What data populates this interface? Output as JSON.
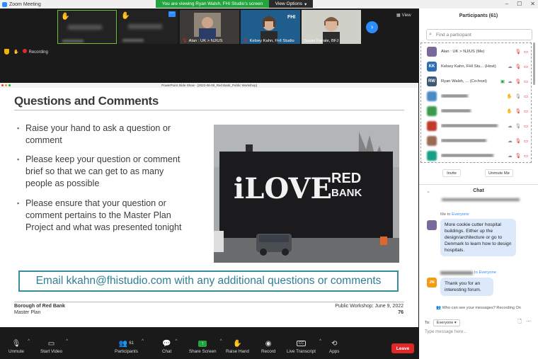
{
  "window": {
    "title": "Zoom Meeting"
  },
  "banner": {
    "text": "You are viewing Ryan Walsh, FHI Studio's screen",
    "view_options": "View Options"
  },
  "gallery": {
    "view_label": "View",
    "tiles": [
      {
        "name": "Alan : UK > NJ/US",
        "hand": true
      },
      {
        "name": "Kelsey Kahn, FHI Studio"
      },
      {
        "name": "Susan Favate, BFJ"
      }
    ]
  },
  "security": {
    "recording_label": "Recording"
  },
  "slide_window": {
    "title": "PowerPoint Slide Show - [2022-06-09_Red Bank_Public Workshop]"
  },
  "slide": {
    "title": "Questions and Comments",
    "bullets": [
      "Raise your hand to ask a question or comment",
      "Please keep your question or comment brief so that we can get to as many people as possible",
      "Please ensure that your question or comment pertains to the Master Plan Project and what was presented tonight"
    ],
    "mural_text_big": "iLOVE",
    "mural_text_red": "RED",
    "mural_text_bank": "BANK",
    "email_line": "Email kkahn@fhistudio.com with any additional questions or comments",
    "footer_org": "Borough of Red Bank",
    "footer_doc": "Master Plan",
    "footer_date": "Public Workshop: June 9, 2022",
    "page_number": "76"
  },
  "toolbar": {
    "unmute": "Unmute",
    "start_video": "Start Video",
    "participants": "Participants",
    "participants_count": "61",
    "chat": "Chat",
    "share_screen": "Share Screen",
    "raise_hand": "Raise Hand",
    "record": "Record",
    "live_transcript": "Live Transcript",
    "live_transcript_badge": "CC",
    "apps": "Apps",
    "leave": "Leave"
  },
  "participants_panel": {
    "title": "Participants (61)",
    "search_placeholder": "Find a participant",
    "rows": [
      {
        "name": "Alan : UK > NJ/US (Me)",
        "initials": "",
        "color": "#7a6a9a"
      },
      {
        "name": "Kelsey Kahn, FHI Stu... (Host)",
        "initials": "KK",
        "color": "#2d6db5"
      },
      {
        "name": "Ryan Walsh, ... (Co-host)",
        "initials": "RW",
        "color": "#3c5a73"
      }
    ],
    "invite": "Invite",
    "unmute_me": "Unmute Me"
  },
  "chat_panel": {
    "title": "Chat",
    "msg1_meta_prefix": "Me to ",
    "msg1_meta_target": "Everyone",
    "msg1_text": "More cookie cutter hospital buildings. Either up the design/architecture or go to Denmark to learn how to design hospitals.",
    "msg2_meta_target": "to Everyone",
    "msg2_initials": "JN",
    "msg2_text": "Thank you for an interesting forum.",
    "who_can_see": "Who can see your messages? Recording On",
    "to_label": "To:",
    "to_value": "Everyone",
    "input_placeholder": "Type message here..."
  }
}
